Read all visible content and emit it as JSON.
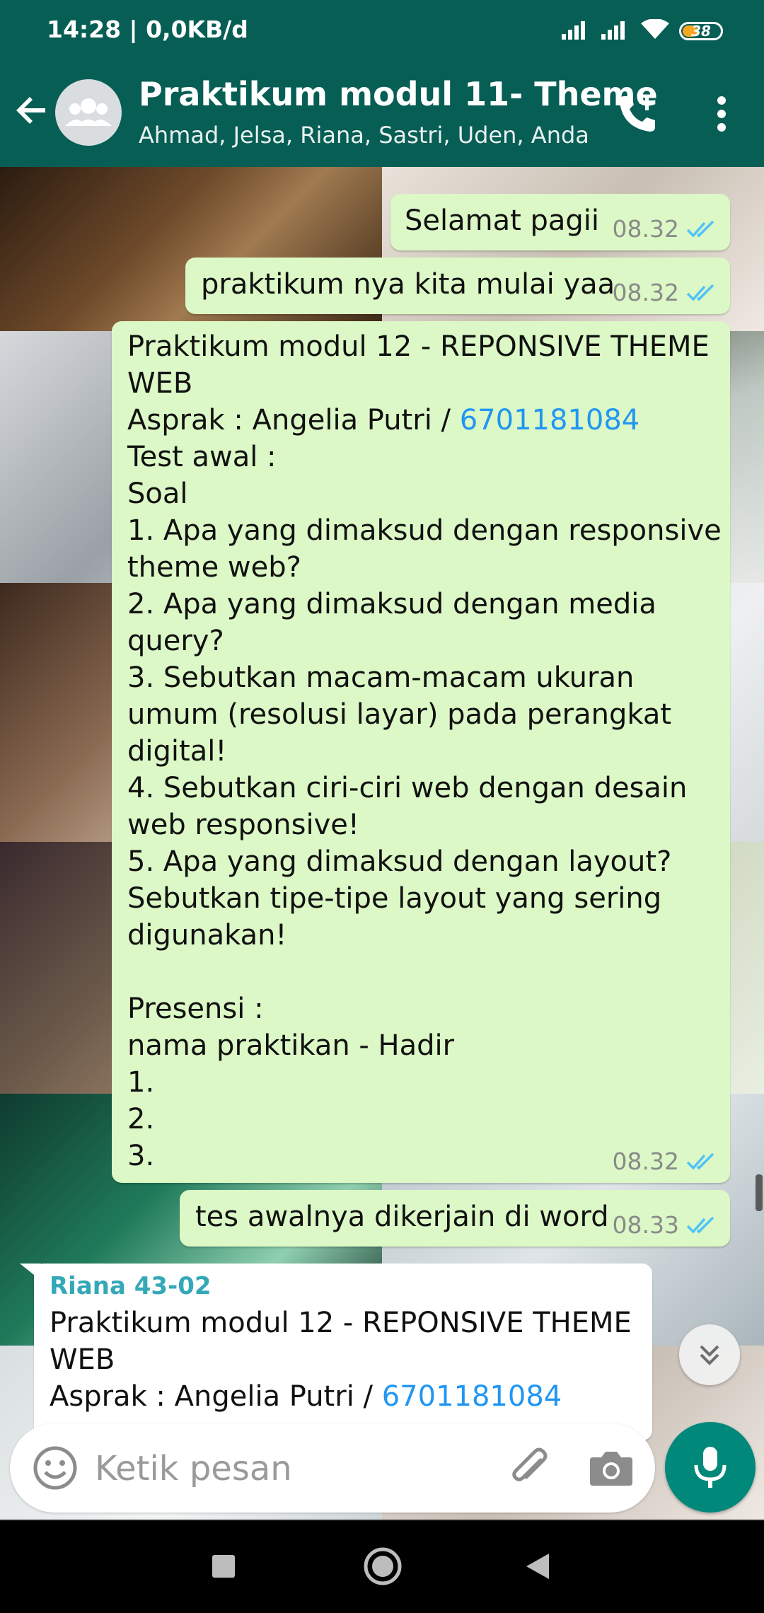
{
  "status_bar": {
    "time_speed": "14:28 | 0,0KB/d",
    "battery": "38",
    "icons": [
      "signal-icon",
      "signal-icon",
      "wifi-icon",
      "battery-icon"
    ]
  },
  "header": {
    "title": "Praktikum modul 11- Theme",
    "members": "Ahmad, Jelsa, Riana, Sastri, Uden, Anda",
    "icons": [
      "back-arrow-icon",
      "group-avatar-icon",
      "add-call-icon",
      "more-vert-icon"
    ]
  },
  "messages": [
    {
      "text": "Selamat pagii",
      "time": "08.32"
    },
    {
      "text": "praktikum nya kita mulai yaa",
      "time": "08.32"
    },
    {
      "line1": "Praktikum modul 12 - REPONSIVE THEME",
      "line2": "WEB",
      "asprak_prefix": "Asprak : Angelia Putri / ",
      "asprak_phone": "6701181084",
      "body": "Test awal :\nSoal\n1. Apa yang dimaksud dengan responsive\ntheme web?\n2. Apa yang dimaksud dengan media\nquery?\n3. Sebutkan macam-macam ukuran\numum (resolusi layar) pada perangkat\ndigital!\n4. Sebutkan ciri-ciri web dengan desain\nweb responsive!\n5. Apa yang dimaksud dengan layout?\nSebutkan tipe-tipe layout yang sering\ndigunakan!\n\nPresensi :\nnama praktikan - Hadir\n1.\n2.\n3.",
      "time": "08.32"
    },
    {
      "text": "tes awalnya dikerjain di word",
      "time": "08.33"
    }
  ],
  "incoming": {
    "sender": "Riana 43-02",
    "line1": "Praktikum modul 12 - REPONSIVE THEME",
    "line2": "WEB",
    "asprak_prefix": "Asprak : Angelia Putri / ",
    "asprak_phone": "6701181084"
  },
  "composer": {
    "placeholder": "Ketik pesan",
    "icons": [
      "emoji-icon",
      "attach-icon",
      "camera-icon",
      "mic-icon",
      "scroll-down-icon"
    ]
  },
  "colors": {
    "header": "#075e54",
    "outgoing_bubble": "#dcf8c6",
    "tick_blue": "#4fc3f7",
    "link": "#2196f3",
    "sender_name": "#35a8b8",
    "mic_button": "#00897b"
  },
  "navigation": {
    "icons": [
      "recents-square-icon",
      "home-circle-icon",
      "back-triangle-icon"
    ]
  }
}
